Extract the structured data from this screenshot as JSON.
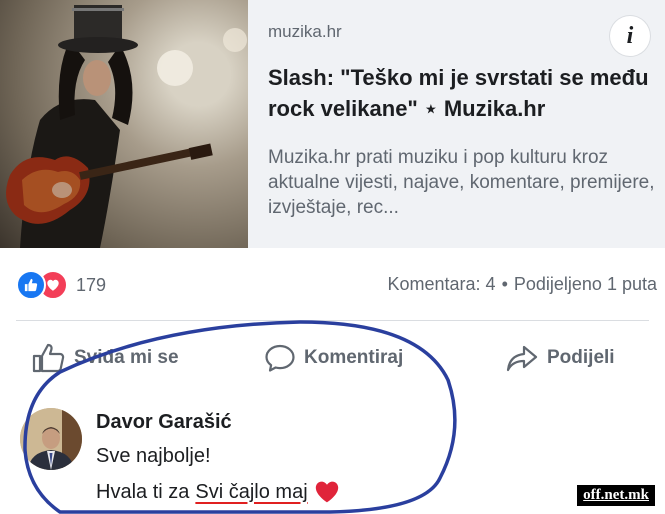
{
  "link_preview": {
    "domain": "muzika.hr",
    "headline": "Slash: \"Teško mi je svrstati se među rock velikane\" ⋆ Muzika.hr",
    "description": "Muzika.hr prati muziku i pop kulturu kroz aktualne vijesti, najave, komentare, premijere, izvještaje, rec...",
    "info_icon": "i"
  },
  "reactions": {
    "count": "179",
    "types": [
      "like-icon",
      "love-icon"
    ]
  },
  "stats": {
    "comments": "Komentara: 4",
    "separator": "•",
    "shares": "Podijeljeno 1 puta"
  },
  "actions": {
    "like": "Sviđa mi se",
    "comment": "Komentiraj",
    "share": "Podijeli"
  },
  "comment": {
    "author": "Davor Garašić",
    "line1": "Sve najbolje!",
    "line2_prefix": "Hvala ti za",
    "line2_highlight": "Svi čajlo maj"
  },
  "watermark": "off.net.mk",
  "colors": {
    "like_blue": "#1877f2",
    "love_red": "#f33e58",
    "annotation_blue": "#2a3f9e",
    "annotation_red": "#e02020"
  }
}
